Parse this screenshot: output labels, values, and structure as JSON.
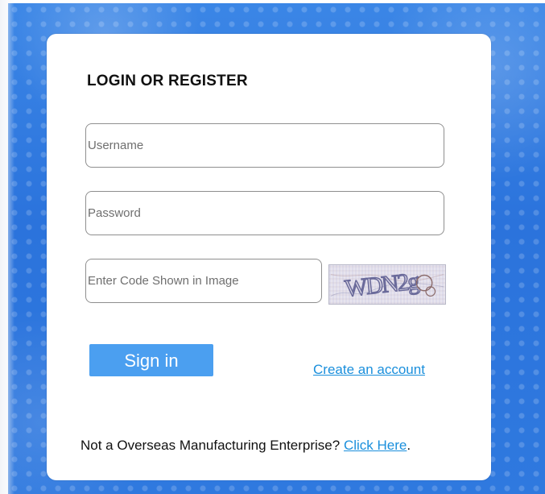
{
  "login": {
    "title": "LOGIN OR REGISTER",
    "username_placeholder": "Username",
    "password_placeholder": "Password",
    "code_placeholder": "Enter Code Shown in Image",
    "captcha_text": "WDN2g",
    "sign_in_label": "Sign in",
    "create_account_label": "Create an account",
    "footer_text": "Not a Overseas Manufacturing Enterprise?",
    "footer_link_label": "Click Here",
    "footer_period": "."
  },
  "colors": {
    "accent": "#4b9ff0",
    "link": "#1a8fdc",
    "background": "#2f79df"
  }
}
